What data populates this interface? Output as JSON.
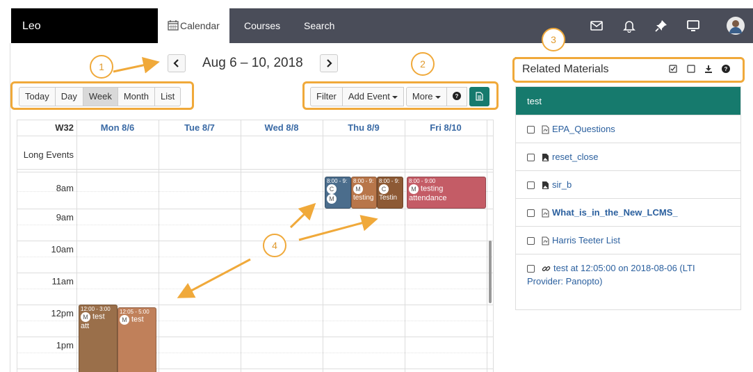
{
  "topbar": {
    "brand": "Leo",
    "tabs": [
      {
        "label": "Calendar",
        "icon": "calendar-icon"
      },
      {
        "label": "Courses"
      },
      {
        "label": "Search"
      }
    ],
    "icons": [
      "mail-icon",
      "bell-icon",
      "pin-icon",
      "monitor-icon",
      "avatar"
    ]
  },
  "calendar": {
    "title": "Aug 6 – 10, 2018",
    "view_buttons": [
      "Today",
      "Day",
      "Week",
      "Month",
      "List"
    ],
    "active_view": "Week",
    "action_buttons": {
      "filter": "Filter",
      "add_event": "Add Event",
      "more": "More"
    },
    "week_label": "W32",
    "days": [
      "Mon 8/6",
      "Tue 8/7",
      "Wed 8/8",
      "Thu 8/9",
      "Fri 8/10"
    ],
    "long_events_label": "Long Events",
    "times": [
      "8am",
      "9am",
      "10am",
      "11am",
      "12pm",
      "1pm"
    ],
    "events": [
      {
        "time": "8:00 - 9:",
        "badge": "C",
        "badge2": "M",
        "title": "",
        "color": "#4b6d8c"
      },
      {
        "time": "8:00 - 9:",
        "badge": "M",
        "title": "testing",
        "color": "#b8764a"
      },
      {
        "time": "8:00 - 9:",
        "badge": "C",
        "title": "Testin",
        "color": "#8d5a35"
      },
      {
        "time": "8:00 - 9:00",
        "badge": "M",
        "title": "testing",
        "title2": "attendance",
        "color": "#c45c66"
      },
      {
        "time": "12:00 - 3:00",
        "badge": "M",
        "title": "test",
        "title2": "att",
        "color": "#9a6f4a"
      },
      {
        "time": "12:05 - 5:00",
        "badge": "M",
        "title": "test",
        "color": "#c0805a"
      }
    ]
  },
  "sidebar": {
    "title": "Related Materials",
    "folder": "test",
    "items": [
      {
        "label": "EPA_Questions",
        "icon": "pdf-file-icon"
      },
      {
        "label": "reset_close",
        "icon": "image-file-icon"
      },
      {
        "label": "sir_b",
        "icon": "image-file-icon"
      },
      {
        "label": "What_is_in_the_New_LCMS_",
        "icon": "pdf-file-icon",
        "bold": true
      },
      {
        "label": "Harris Teeter List",
        "icon": "pdf-file-icon"
      },
      {
        "label": "test at 12:05:00 on 2018-08-06 (LTI Provider: Panopto)",
        "icon": "link-icon"
      }
    ]
  },
  "callouts": [
    "1",
    "2",
    "3",
    "4"
  ],
  "colors": {
    "accent": "#167a6d",
    "navbar": "#4a4d59",
    "callout": "#f0a93a",
    "link": "#2a5f9e"
  }
}
